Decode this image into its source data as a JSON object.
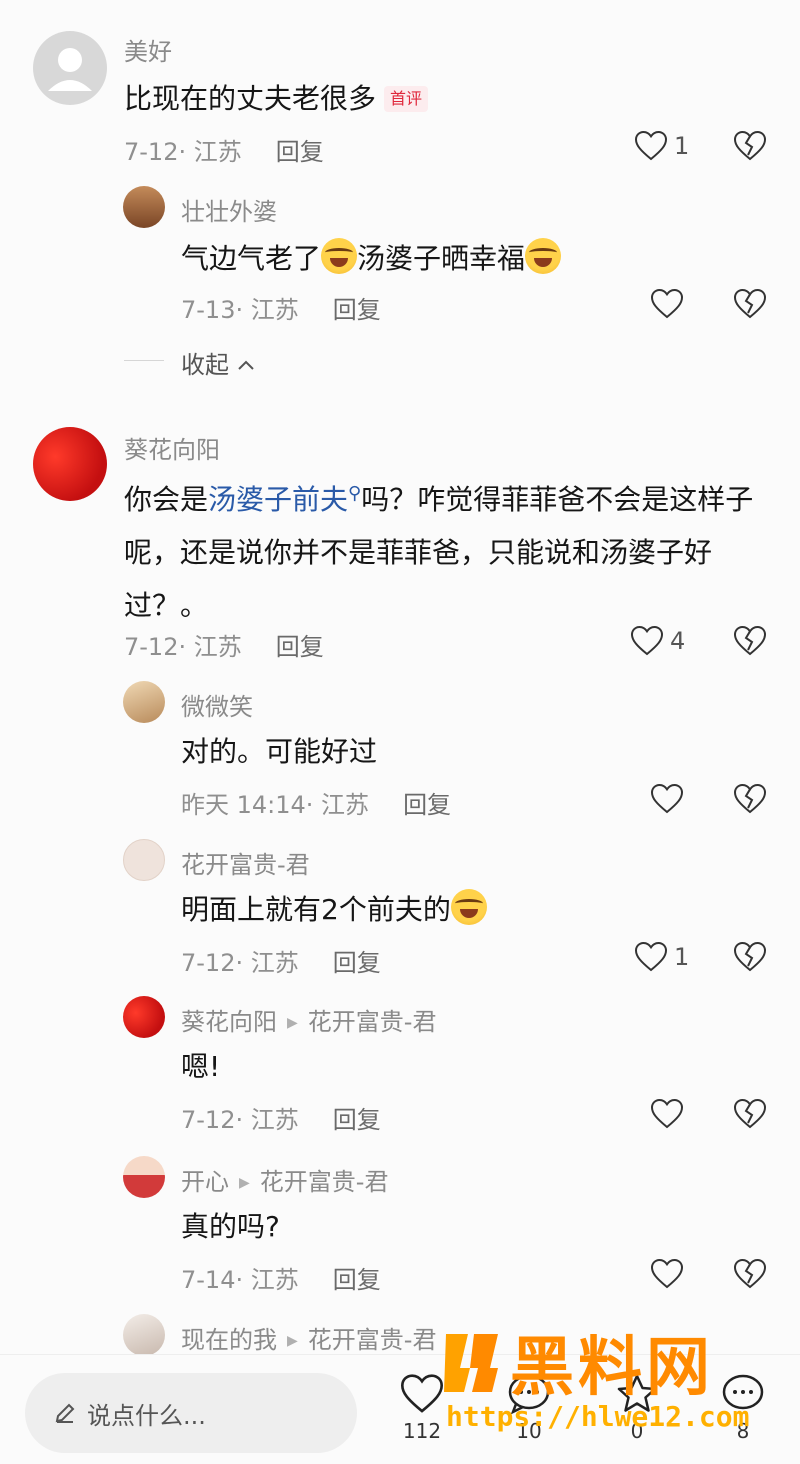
{
  "comments": [
    {
      "user": "美好",
      "text": "比现在的丈夫老很多",
      "badge": "首评",
      "meta": "7-12· 江苏",
      "reply_label": "回复",
      "likes": "1"
    },
    {
      "user": "壮壮外婆",
      "text_parts": [
        "气边气老了",
        "汤婆子晒幸福"
      ],
      "meta": "7-13· 江苏",
      "reply_label": "回复",
      "likes": ""
    },
    {
      "user": "葵花向阳",
      "text_before": "你会是",
      "text_link": "汤婆子前夫",
      "text_after": "吗？咋觉得菲菲爸不会是这样子呢，还是说你并不是菲菲爸，只能说和汤婆子好过？。",
      "meta": "7-12· 江苏",
      "reply_label": "回复",
      "likes": "4"
    },
    {
      "user": "微微笑",
      "text": "对的。可能好过",
      "meta": "昨天 14:14· 江苏",
      "reply_label": "回复",
      "likes": ""
    },
    {
      "user": "花开富贵-君",
      "text": "明面上就有2个前夫的",
      "meta": "7-12· 江苏",
      "reply_label": "回复",
      "likes": "1"
    },
    {
      "user": "葵花向阳",
      "reply_to": "花开富贵-君",
      "text": "嗯!",
      "meta": "7-12· 江苏",
      "reply_label": "回复",
      "likes": ""
    },
    {
      "user": "开心",
      "reply_to": "花开富贵-君",
      "text": "真的吗?",
      "meta": "7-14· 江苏",
      "reply_label": "回复",
      "likes": ""
    },
    {
      "user": "现在的我",
      "reply_to": "花开富贵-君"
    }
  ],
  "collapse_label": "收起",
  "bottom_bar": {
    "input_placeholder": "说点什么...",
    "like_count": "112",
    "comment_count": "10",
    "star_count": "0",
    "share_count": "8"
  },
  "watermark": {
    "title": "黑料网",
    "url": "https://hlwe12.com"
  },
  "colors": {
    "link": "#2a5aa8",
    "badge": "#e0283c",
    "watermark": "#ff8a00"
  }
}
